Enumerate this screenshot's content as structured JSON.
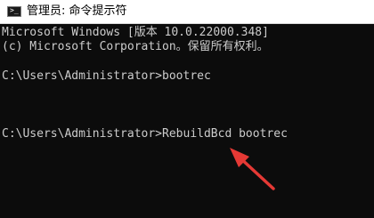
{
  "window": {
    "title": "管理员: 命令提示符",
    "icon": "cmd-icon",
    "icon_glyph": ">_"
  },
  "console": {
    "lines": [
      "Microsoft Windows [版本 10.0.22000.348]",
      "(c) Microsoft Corporation。保留所有权利。",
      "C:\\Users\\Administrator>bootrec",
      "C:\\Users\\Administrator>RebuildBcd bootrec"
    ]
  },
  "annotation": {
    "arrow_color": "#e53935"
  }
}
